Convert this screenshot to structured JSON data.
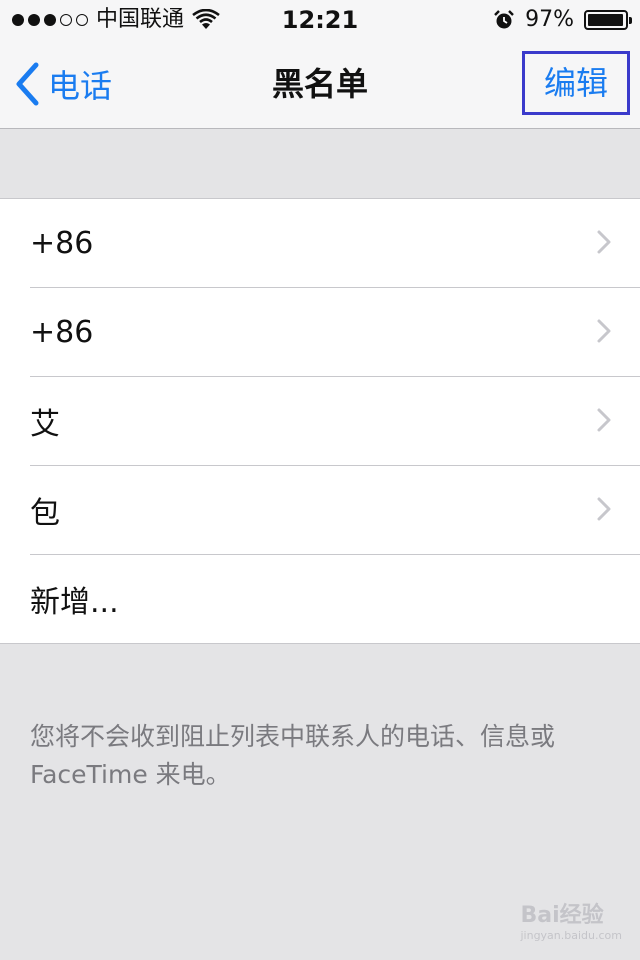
{
  "status_bar": {
    "signal_bars_full": 3,
    "signal_bars_total": 5,
    "carrier": "中国联通",
    "time": "12:21",
    "battery_percent_text": "97%",
    "battery_level": 0.97
  },
  "navbar": {
    "back_label": "电话",
    "title": "黑名单",
    "edit_label": "编辑"
  },
  "blocked_list": {
    "items": [
      {
        "label": "+86"
      },
      {
        "label": "+86"
      },
      {
        "label": "艾"
      },
      {
        "label": "包"
      }
    ],
    "add_new_label": "新增..."
  },
  "footer_text": "您将不会收到阻止列表中联系人的电话、信息或 FaceTime 来电。",
  "watermark": {
    "text": "Bai经验",
    "subtext": "jingyan.baidu.com"
  },
  "colors": {
    "accent": "#1a7cf0",
    "highlight_box": "#3a3acb",
    "background": "#e4e4e6"
  }
}
